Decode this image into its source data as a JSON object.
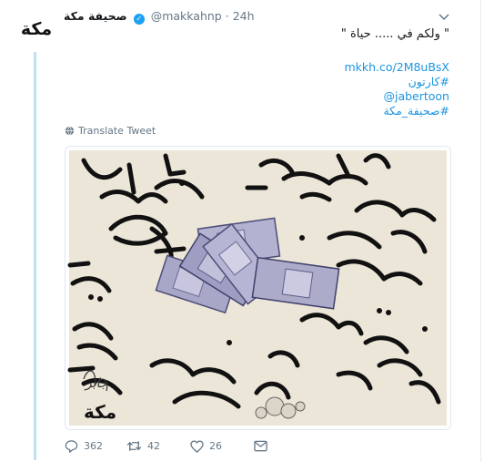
{
  "account": {
    "avatar_text": "مكة",
    "display_name": "صحيفة مكة",
    "handle": "@makkahnp",
    "separator": "·",
    "time": "24h"
  },
  "tweet": {
    "text": "\" ولكم في ..... حياة \"",
    "links": [
      "mkkh.co/2M8uBsX",
      "#كارتون",
      "@jabertoon",
      "#صحيفة_مكة"
    ],
    "translate_label": "Translate Tweet"
  },
  "media": {
    "watermark_text": "مكة",
    "signature_text": "جابر"
  },
  "stats": {
    "replies": "362",
    "retweets": "42",
    "likes": "26"
  },
  "colors": {
    "link": "#1b95e0",
    "verified": "#1da1f2",
    "muted": "#657786",
    "thread": "#bde0f5",
    "cartoon_bg": "#ece6d8",
    "banknote": "#a8a7c8"
  },
  "icons": [
    "verified-badge-icon",
    "chevron-down-icon",
    "globe-icon",
    "reply-icon",
    "retweet-icon",
    "like-icon",
    "message-icon"
  ]
}
